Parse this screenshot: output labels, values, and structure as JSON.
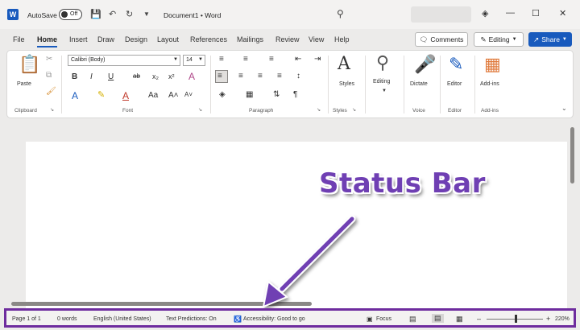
{
  "titlebar": {
    "app_letter": "W",
    "autosave_label": "AutoSave",
    "autosave_state": "Off",
    "document_title": "Document1 • Word"
  },
  "menu": {
    "tabs": [
      "File",
      "Home",
      "Insert",
      "Draw",
      "Design",
      "Layout",
      "References",
      "Mailings",
      "Review",
      "View",
      "Help"
    ],
    "active_tab": "Home",
    "comments_label": "Comments",
    "editing_label": "Editing",
    "share_label": "Share"
  },
  "ribbon": {
    "clipboard": {
      "paste_label": "Paste",
      "group_label": "Clipboard"
    },
    "font": {
      "font_name": "Calibri (Body)",
      "font_size": "14",
      "group_label": "Font"
    },
    "paragraph": {
      "group_label": "Paragraph"
    },
    "styles": {
      "button_label": "Styles",
      "group_label": "Styles"
    },
    "editing": {
      "button_label": "Editing"
    },
    "voice": {
      "button_label": "Dictate",
      "group_label": "Voice"
    },
    "editor": {
      "button_label": "Editor",
      "group_label": "Editor"
    },
    "addins": {
      "button_label": "Add-ins",
      "group_label": "Add-ins"
    }
  },
  "annotation": {
    "text": "Status Bar",
    "color": "#6f3fb3"
  },
  "statusbar": {
    "page": "Page 1 of 1",
    "words": "0 words",
    "language": "English (United States)",
    "predictions": "Text Predictions: On",
    "accessibility": "Accessibility: Good to go",
    "focus": "Focus",
    "zoom": "220%",
    "border_color": "#6e2c9e"
  },
  "colors": {
    "accent": "#185abd"
  }
}
